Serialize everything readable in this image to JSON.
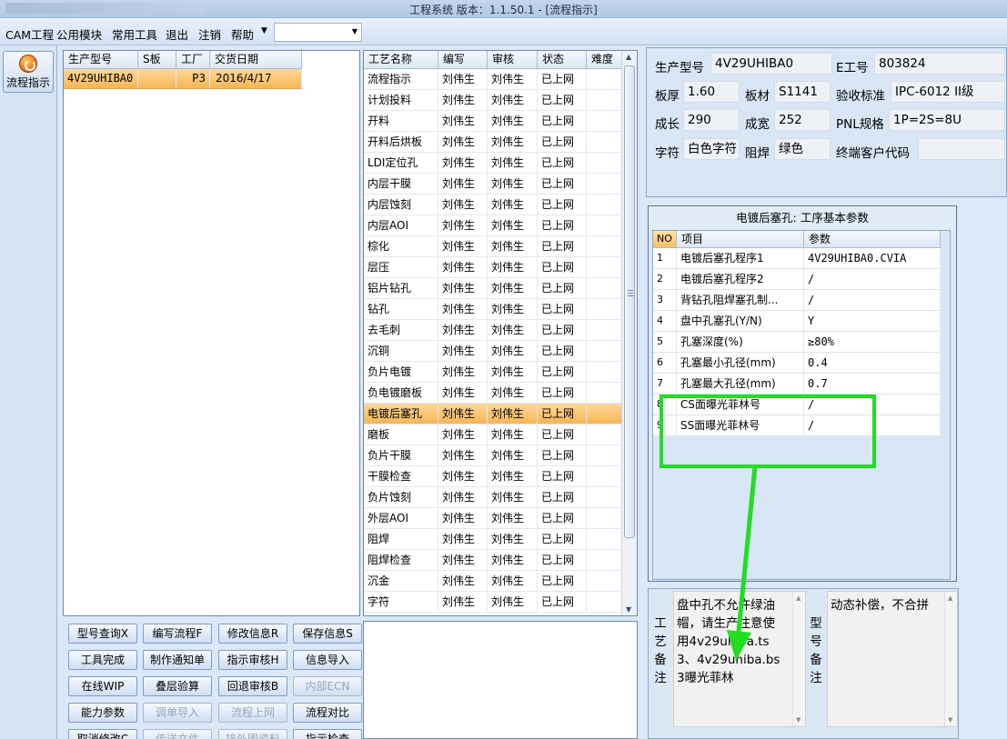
{
  "window": {
    "title": "工程系统    版本：1.1.50.1 - [流程指示]"
  },
  "menu": {
    "items": [
      "CAM工程",
      "公用模块",
      "常用工具",
      "退出",
      "注销",
      "帮助"
    ],
    "combo_value": ""
  },
  "launcher": {
    "flow_label": "流程指示"
  },
  "orders": {
    "columns": [
      "生产型号",
      "S板",
      "工厂",
      "交货日期"
    ],
    "rows": [
      {
        "model": "4V29UHIBA0",
        "sboard": "",
        "factory": "P3",
        "date": "2016/4/17"
      }
    ]
  },
  "process": {
    "columns": [
      "工艺名称",
      "编写",
      "审核",
      "状态",
      "难度"
    ],
    "rows": [
      {
        "name": "流程指示",
        "author": "刘伟生",
        "reviewer": "刘伟生",
        "status": "已上网",
        "difficulty": ""
      },
      {
        "name": "计划投料",
        "author": "刘伟生",
        "reviewer": "刘伟生",
        "status": "已上网",
        "difficulty": ""
      },
      {
        "name": "开料",
        "author": "刘伟生",
        "reviewer": "刘伟生",
        "status": "已上网",
        "difficulty": ""
      },
      {
        "name": "开料后烘板",
        "author": "刘伟生",
        "reviewer": "刘伟生",
        "status": "已上网",
        "difficulty": ""
      },
      {
        "name": "LDI定位孔",
        "author": "刘伟生",
        "reviewer": "刘伟生",
        "status": "已上网",
        "difficulty": ""
      },
      {
        "name": "内层干膜",
        "author": "刘伟生",
        "reviewer": "刘伟生",
        "status": "已上网",
        "difficulty": ""
      },
      {
        "name": "内层蚀刻",
        "author": "刘伟生",
        "reviewer": "刘伟生",
        "status": "已上网",
        "difficulty": ""
      },
      {
        "name": "内层AOI",
        "author": "刘伟生",
        "reviewer": "刘伟生",
        "status": "已上网",
        "difficulty": ""
      },
      {
        "name": "棕化",
        "author": "刘伟生",
        "reviewer": "刘伟生",
        "status": "已上网",
        "difficulty": ""
      },
      {
        "name": "层压",
        "author": "刘伟生",
        "reviewer": "刘伟生",
        "status": "已上网",
        "difficulty": ""
      },
      {
        "name": "铝片钻孔",
        "author": "刘伟生",
        "reviewer": "刘伟生",
        "status": "已上网",
        "difficulty": ""
      },
      {
        "name": "钻孔",
        "author": "刘伟生",
        "reviewer": "刘伟生",
        "status": "已上网",
        "difficulty": ""
      },
      {
        "name": "去毛刺",
        "author": "刘伟生",
        "reviewer": "刘伟生",
        "status": "已上网",
        "difficulty": ""
      },
      {
        "name": "沉铜",
        "author": "刘伟生",
        "reviewer": "刘伟生",
        "status": "已上网",
        "difficulty": ""
      },
      {
        "name": "负片电镀",
        "author": "刘伟生",
        "reviewer": "刘伟生",
        "status": "已上网",
        "difficulty": ""
      },
      {
        "name": "负电镀磨板",
        "author": "刘伟生",
        "reviewer": "刘伟生",
        "status": "已上网",
        "difficulty": ""
      },
      {
        "name": "电镀后塞孔",
        "author": "刘伟生",
        "reviewer": "刘伟生",
        "status": "已上网",
        "difficulty": ""
      },
      {
        "name": "磨板",
        "author": "刘伟生",
        "reviewer": "刘伟生",
        "status": "已上网",
        "difficulty": ""
      },
      {
        "name": "负片干膜",
        "author": "刘伟生",
        "reviewer": "刘伟生",
        "status": "已上网",
        "difficulty": ""
      },
      {
        "name": "干膜检查",
        "author": "刘伟生",
        "reviewer": "刘伟生",
        "status": "已上网",
        "difficulty": ""
      },
      {
        "name": "负片蚀刻",
        "author": "刘伟生",
        "reviewer": "刘伟生",
        "status": "已上网",
        "difficulty": ""
      },
      {
        "name": "外层AOI",
        "author": "刘伟生",
        "reviewer": "刘伟生",
        "status": "已上网",
        "difficulty": ""
      },
      {
        "name": "阻焊",
        "author": "刘伟生",
        "reviewer": "刘伟生",
        "status": "已上网",
        "difficulty": ""
      },
      {
        "name": "阻焊检查",
        "author": "刘伟生",
        "reviewer": "刘伟生",
        "status": "已上网",
        "difficulty": ""
      },
      {
        "name": "沉金",
        "author": "刘伟生",
        "reviewer": "刘伟生",
        "status": "已上网",
        "difficulty": ""
      },
      {
        "name": "字符",
        "author": "刘伟生",
        "reviewer": "刘伟生",
        "status": "已上网",
        "difficulty": ""
      }
    ],
    "selected": "电镀后塞孔"
  },
  "buttons": [
    {
      "label": "型号查询X",
      "enabled": true
    },
    {
      "label": "编写流程F",
      "enabled": true
    },
    {
      "label": "修改信息R",
      "enabled": true
    },
    {
      "label": "保存信息S",
      "enabled": true
    },
    {
      "label": "工具完成",
      "enabled": true
    },
    {
      "label": "制作通知单",
      "enabled": true
    },
    {
      "label": "指示审核H",
      "enabled": true
    },
    {
      "label": "信息导入",
      "enabled": true
    },
    {
      "label": "在线WIP",
      "enabled": true
    },
    {
      "label": "叠层验算",
      "enabled": true
    },
    {
      "label": "回退审核B",
      "enabled": true
    },
    {
      "label": "内部ECN",
      "enabled": false
    },
    {
      "label": "能力参数",
      "enabled": true
    },
    {
      "label": "调单导入",
      "enabled": false
    },
    {
      "label": "流程上网",
      "enabled": false
    },
    {
      "label": "流程对比",
      "enabled": true
    },
    {
      "label": "取消修改C",
      "enabled": true
    },
    {
      "label": "传送文件",
      "enabled": false
    },
    {
      "label": "接外围资料",
      "enabled": false
    },
    {
      "label": "指示检查",
      "enabled": true
    }
  ],
  "info": {
    "model_label": "生产型号",
    "model_value": "4V29UHIBA0",
    "eno_label": "E工号",
    "eno_value": "803824",
    "thickness_label": "板厚",
    "thickness_value": "1.60",
    "material_label": "板材",
    "material_value": "S1141",
    "standard_label": "验收标准",
    "standard_value": "IPC-6012 II级",
    "length_label": "成长",
    "length_value": "290",
    "width_label": "成宽",
    "width_value": "252",
    "pnl_label": "PNL规格",
    "pnl_value": "1P=2S=8U",
    "char_label": "字符",
    "char_value": "白色字符",
    "mask_label": "阻焊",
    "mask_value": "绿色",
    "customer_label": "终端客户代码",
    "customer_value": ""
  },
  "params": {
    "title": "电镀后塞孔: 工序基本参数",
    "columns": [
      "NO",
      "项目",
      "参数"
    ],
    "rows": [
      {
        "no": "1",
        "item": "电镀后塞孔程序1",
        "value": "4V29UHIBA0.CVIA"
      },
      {
        "no": "2",
        "item": "电镀后塞孔程序2",
        "value": "/"
      },
      {
        "no": "3",
        "item": "背钻孔阻焊塞孔制...",
        "value": "/"
      },
      {
        "no": "4",
        "item": "盘中孔塞孔(Y/N)",
        "value": "Y"
      },
      {
        "no": "5",
        "item": "孔塞深度(%)",
        "value": "≥80%"
      },
      {
        "no": "6",
        "item": "孔塞最小孔径(mm)",
        "value": "0.4"
      },
      {
        "no": "7",
        "item": "孔塞最大孔径(mm)",
        "value": "0.7"
      },
      {
        "no": "8",
        "item": "CS面曝光菲林号",
        "value": "/"
      },
      {
        "no": "9",
        "item": "SS面曝光菲林号",
        "value": "/"
      }
    ]
  },
  "notes": {
    "process_label": "工艺备注",
    "process_text": "盘中孔不允许绿油帽，请生产注意使用4v29uhiba.ts3、4v29uhiba.bs3曝光菲林",
    "model_label": "型号备注",
    "model_text": "动态补偿，不合拼"
  },
  "colors": {
    "annotation": "#22dd22",
    "selected_row": "#f7b451"
  }
}
